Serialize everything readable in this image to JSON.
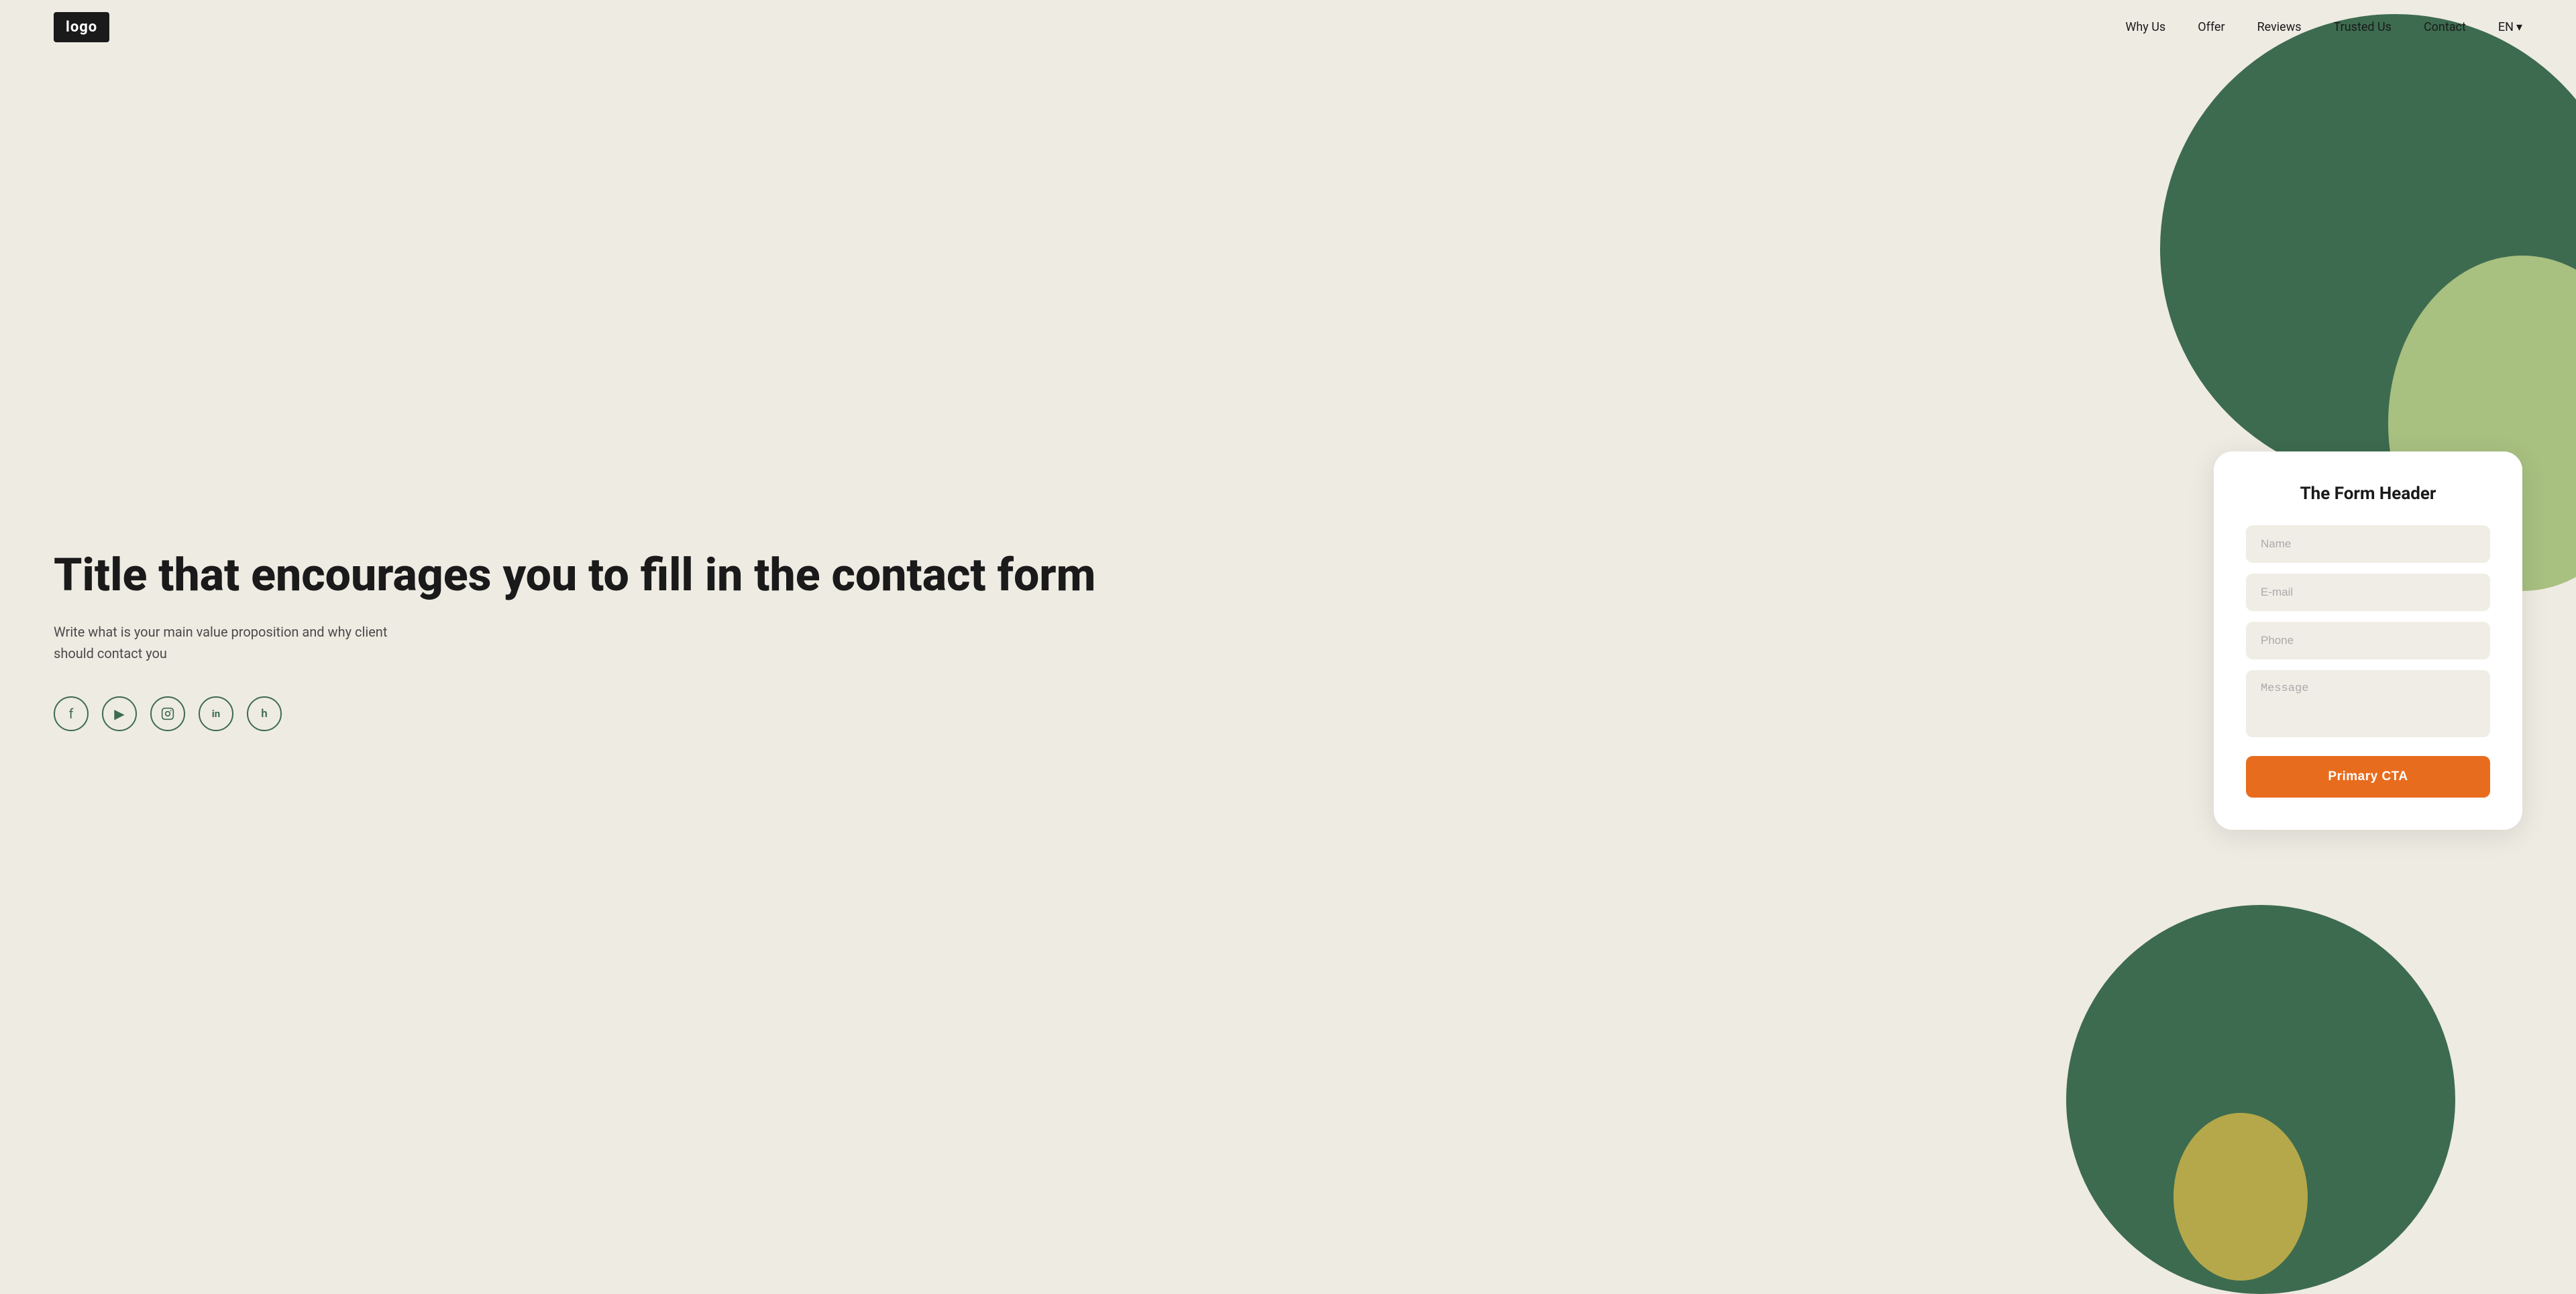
{
  "header": {
    "logo_text": "logo",
    "nav": {
      "items": [
        {
          "label": "Why Us",
          "id": "why-us"
        },
        {
          "label": "Offer",
          "id": "offer"
        },
        {
          "label": "Reviews",
          "id": "reviews"
        },
        {
          "label": "Trusted Us",
          "id": "trusted-us"
        },
        {
          "label": "Contact",
          "id": "contact"
        }
      ],
      "lang": "EN",
      "lang_arrow": "▾"
    }
  },
  "hero": {
    "title": "Title that encourages you to fill in the contact form",
    "subtitle": "Write what is your main value proposition and why client should contact you",
    "social_icons": [
      {
        "id": "facebook",
        "symbol": "f",
        "label": "facebook-icon"
      },
      {
        "id": "youtube",
        "symbol": "▶",
        "label": "youtube-icon"
      },
      {
        "id": "instagram",
        "symbol": "◻",
        "label": "instagram-icon"
      },
      {
        "id": "linkedin",
        "symbol": "in",
        "label": "linkedin-icon"
      },
      {
        "id": "houzz",
        "symbol": "h",
        "label": "houzz-icon"
      }
    ]
  },
  "form": {
    "header": "The Form Header",
    "name_placeholder": "Name",
    "email_placeholder": "E-mail",
    "phone_placeholder": "Phone",
    "message_placeholder": "Message",
    "cta_label": "Primary CTA"
  },
  "colors": {
    "background": "#eeebe3",
    "dark_circle": "#3d6b4f",
    "light_green": "#a8c080",
    "olive": "#b5a84a",
    "cta_orange": "#e86c1e",
    "logo_bg": "#1a1a1a"
  }
}
